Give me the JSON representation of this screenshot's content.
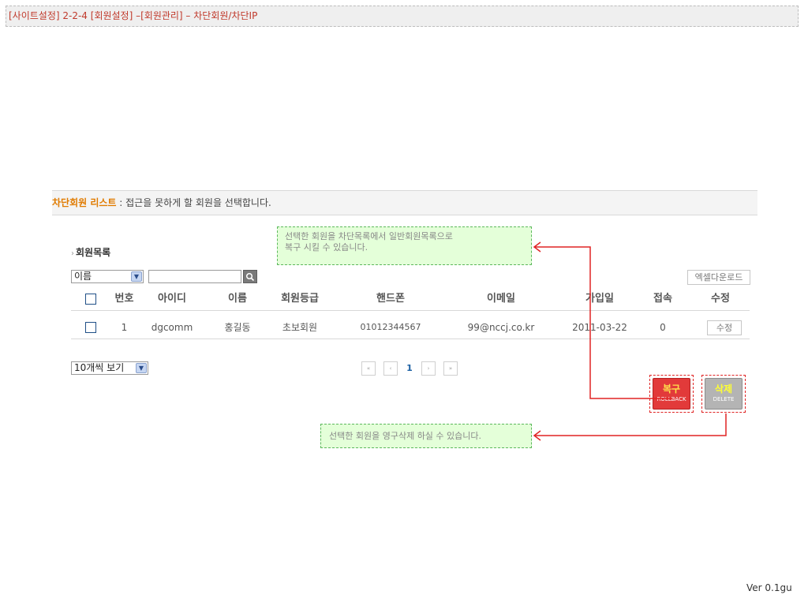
{
  "header": {
    "text": "[사이트설정] 2-2-4 [회원설정] –[회원관리] – 차단회원/차단IP"
  },
  "section": {
    "title": "차단회원 리스트",
    "desc": " : 접근을 못하게 할 회원을 선택합니다."
  },
  "callouts": {
    "top_line1": "선택한 회원을 차단목록에서 일반회원목록으로",
    "top_line2": "복구 시킬 수 있습니다.",
    "bottom": "선택한 회원을 영구삭제 하실 수 있습니다."
  },
  "list": {
    "bullet": "›",
    "title": "회원목록",
    "search_field": "이름",
    "search_value": "",
    "excel_label": "엑셀다운로드",
    "columns": [
      "번호",
      "아이디",
      "이름",
      "회원등급",
      "핸드폰",
      "이메일",
      "가입일",
      "접속",
      "수정"
    ],
    "rows": [
      {
        "no": "1",
        "id": "dgcomm",
        "name": "홍길동",
        "grade": "초보회원",
        "phone": "01012344567",
        "email": "99@nccj.co.kr",
        "joined": "2011-03-22",
        "visits": "0",
        "edit": "수정"
      }
    ],
    "view_select": "10개씩 보기"
  },
  "pager": {
    "first": "«",
    "prev": "‹",
    "current": "1",
    "next": "›",
    "last": "»"
  },
  "actions": {
    "rollback_main": "복구",
    "rollback_sub": "ROLLBACK",
    "delete_main": "삭제",
    "delete_sub": "DELETE"
  },
  "icons": {
    "search": "search-icon",
    "dropdown": "chevron-down-icon"
  },
  "colors": {
    "accent": "#e07b00",
    "header_text": "#c0392b",
    "arrow": "#e02424",
    "callout_bg": "#e4ffd9"
  },
  "footer": {
    "version": "Ver 0.1gu"
  }
}
